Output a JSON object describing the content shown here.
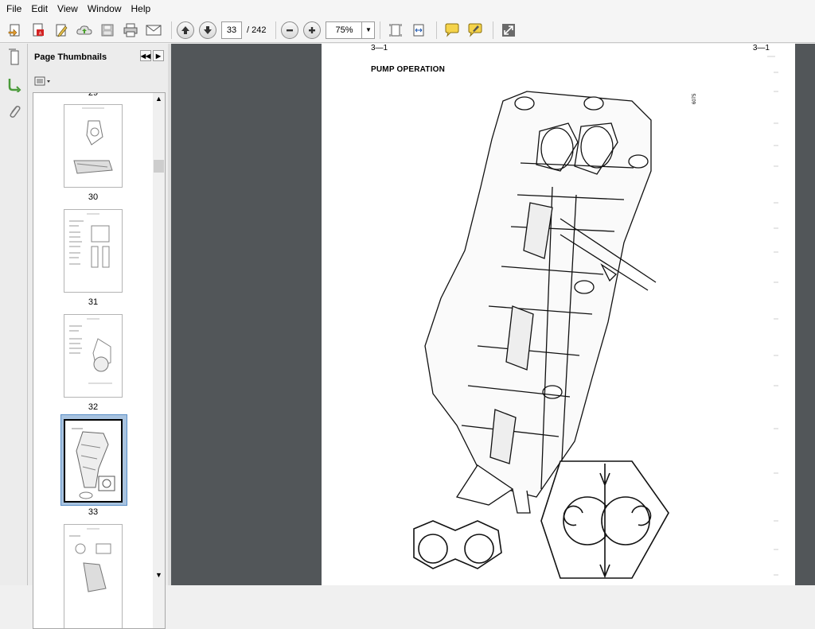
{
  "menu": [
    "File",
    "Edit",
    "View",
    "Window",
    "Help"
  ],
  "toolbar": {
    "page_current": "33",
    "page_total": "/ 242",
    "zoom": "75%"
  },
  "panel": {
    "title": "Page Thumbnails",
    "first_label": "29",
    "thumbnails": [
      {
        "page": "30"
      },
      {
        "page": "31"
      },
      {
        "page": "32"
      },
      {
        "page": "33"
      }
    ]
  },
  "document": {
    "heading": "PUMP OPERATION",
    "page_ref": "3—1",
    "figure_number": "6075"
  }
}
